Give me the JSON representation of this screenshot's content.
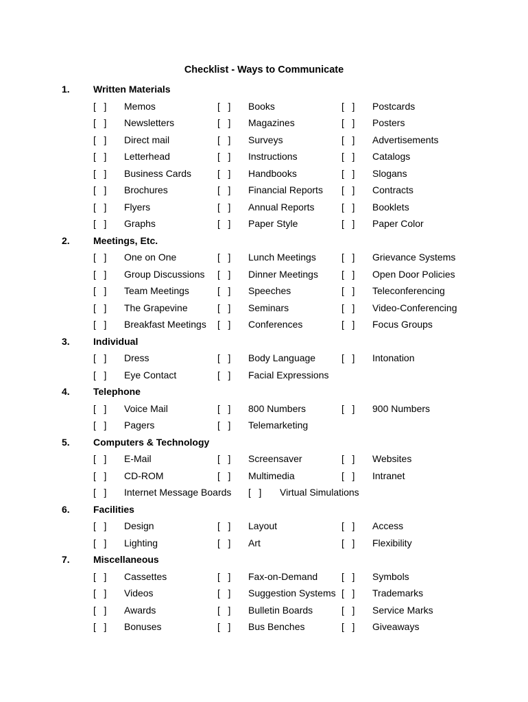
{
  "document": {
    "title": "Checklist - Ways to Communicate",
    "checkbox_glyph": "[   ]",
    "sections": [
      {
        "number": "1.",
        "title": "Written Materials",
        "rows": [
          [
            "Memos",
            "Books",
            "Postcards"
          ],
          [
            "Newsletters",
            "Magazines",
            "Posters"
          ],
          [
            "Direct mail",
            "Surveys",
            "Advertisements"
          ],
          [
            "Letterhead",
            "Instructions",
            "Catalogs"
          ],
          [
            "Business Cards",
            "Handbooks",
            "Slogans"
          ],
          [
            "Brochures",
            "Financial Reports",
            "Contracts"
          ],
          [
            "Flyers",
            "Annual Reports",
            "Booklets"
          ],
          [
            "Graphs",
            "Paper Style",
            "Paper Color"
          ]
        ]
      },
      {
        "number": "2.",
        "title": "Meetings, Etc.",
        "rows": [
          [
            "One on One",
            "Lunch Meetings",
            "Grievance Systems"
          ],
          [
            "Group Discussions",
            "Dinner Meetings",
            "Open Door Policies"
          ],
          [
            "Team Meetings",
            "Speeches",
            "Teleconferencing"
          ],
          [
            "The Grapevine",
            "Seminars",
            "Video-Conferencing"
          ],
          [
            "Breakfast Meetings",
            "Conferences",
            "Focus Groups"
          ]
        ]
      },
      {
        "number": "3.",
        "title": "Individual",
        "rows": [
          [
            "Dress",
            "Body Language",
            "Intonation"
          ],
          [
            "Eye Contact",
            "Facial Expressions"
          ]
        ]
      },
      {
        "number": "4.",
        "title": "Telephone",
        "rows": [
          [
            "Voice Mail",
            "800 Numbers",
            "900 Numbers"
          ],
          [
            "Pagers",
            "Telemarketing"
          ]
        ]
      },
      {
        "number": "5.",
        "title": "Computers & Technology",
        "rows": [
          [
            "E-Mail",
            "Screensaver",
            "Websites"
          ],
          [
            "CD-ROM",
            "Multimedia",
            "Intranet"
          ],
          {
            "wide": true,
            "items": [
              "Internet Message Boards",
              "Virtual Simulations"
            ]
          }
        ]
      },
      {
        "number": "6.",
        "title": "Facilities",
        "rows": [
          [
            "Design",
            "Layout",
            "Access"
          ],
          [
            "Lighting",
            "Art",
            "Flexibility"
          ]
        ]
      },
      {
        "number": "7.",
        "title": "Miscellaneous",
        "rows": [
          [
            "Cassettes",
            "Fax-on-Demand",
            "Symbols"
          ],
          [
            "Videos",
            "Suggestion Systems",
            "Trademarks"
          ],
          [
            "Awards",
            "Bulletin Boards",
            "Service Marks"
          ],
          [
            "Bonuses",
            "Bus Benches",
            "Giveaways"
          ]
        ]
      }
    ]
  }
}
